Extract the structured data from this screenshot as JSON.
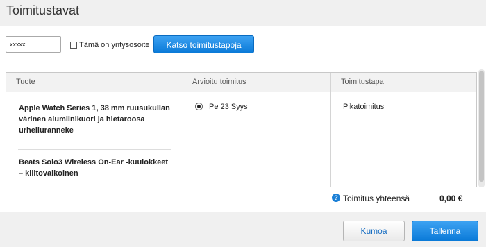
{
  "dialog": {
    "title": "Toimitustavat"
  },
  "postal": {
    "value": "xxxxx"
  },
  "company_checkbox": {
    "label": "Tämä on yritysosoite",
    "checked": false
  },
  "actions": {
    "check_delivery": "Katso toimitustapoja"
  },
  "table": {
    "headers": {
      "product": "Tuote",
      "estimated": "Arvioitu toimitus",
      "method": "Toimitustapa"
    },
    "products": [
      {
        "name": "Apple Watch Series 1, 38 mm ruusukullan värinen alumiinikuori ja hietaroosa urheiluranneke"
      },
      {
        "name": "Beats Solo3 Wireless On-Ear -kuulokkeet – kiiltovalkoinen"
      }
    ],
    "delivery_option": {
      "date": "Pe 23 Syys",
      "selected": true
    },
    "method": "Pikatoimitus"
  },
  "total": {
    "label": "Toimitus yhteensä",
    "amount": "0,00 €"
  },
  "footer": {
    "cancel": "Kumoa",
    "save": "Tallenna"
  },
  "colors": {
    "accent": "#1a7fd6",
    "header_bg": "#f0f0f0"
  }
}
